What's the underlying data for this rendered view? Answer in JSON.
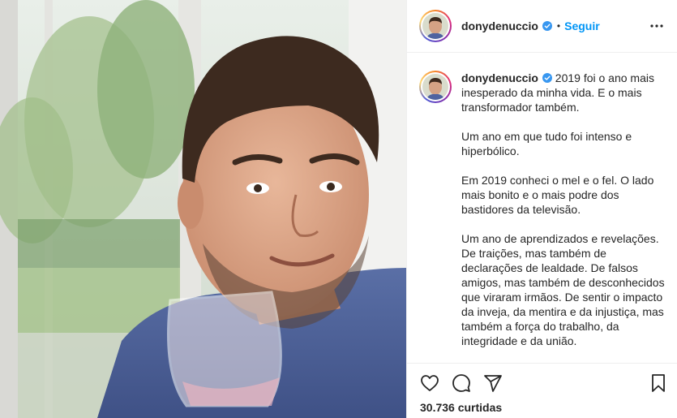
{
  "post": {
    "username": "donydenuccio",
    "follow_label": "Seguir",
    "separator": "•",
    "caption": {
      "username": "donydenuccio",
      "lead": "2019 foi o ano mais inesperado da minha vida. E o mais transformador também.",
      "paragraphs": [
        "Um ano em que tudo foi intenso e hiperbólico.",
        "Em 2019 conheci o mel e o fel. O lado mais bonito e o mais podre dos bastidores da televisão.",
        "Um ano de aprendizados e revelações. De traições, mas também de declarações de lealdade. De falsos amigos, mas também de desconhecidos que viraram irmãos. De sentir o impacto da inveja, da mentira e da injustiça, mas também a força do trabalho, da integridade e da união."
      ]
    },
    "likes_text": "30.736 curtidas"
  },
  "colors": {
    "accent": "#0095f6",
    "verified": "#3897f0",
    "text": "#262626",
    "border": "#efefef"
  },
  "icons": {
    "verified": "verified-badge-icon",
    "more": "more-options-icon",
    "like": "heart-icon",
    "comment": "comment-icon",
    "share": "share-icon",
    "save": "bookmark-icon"
  }
}
